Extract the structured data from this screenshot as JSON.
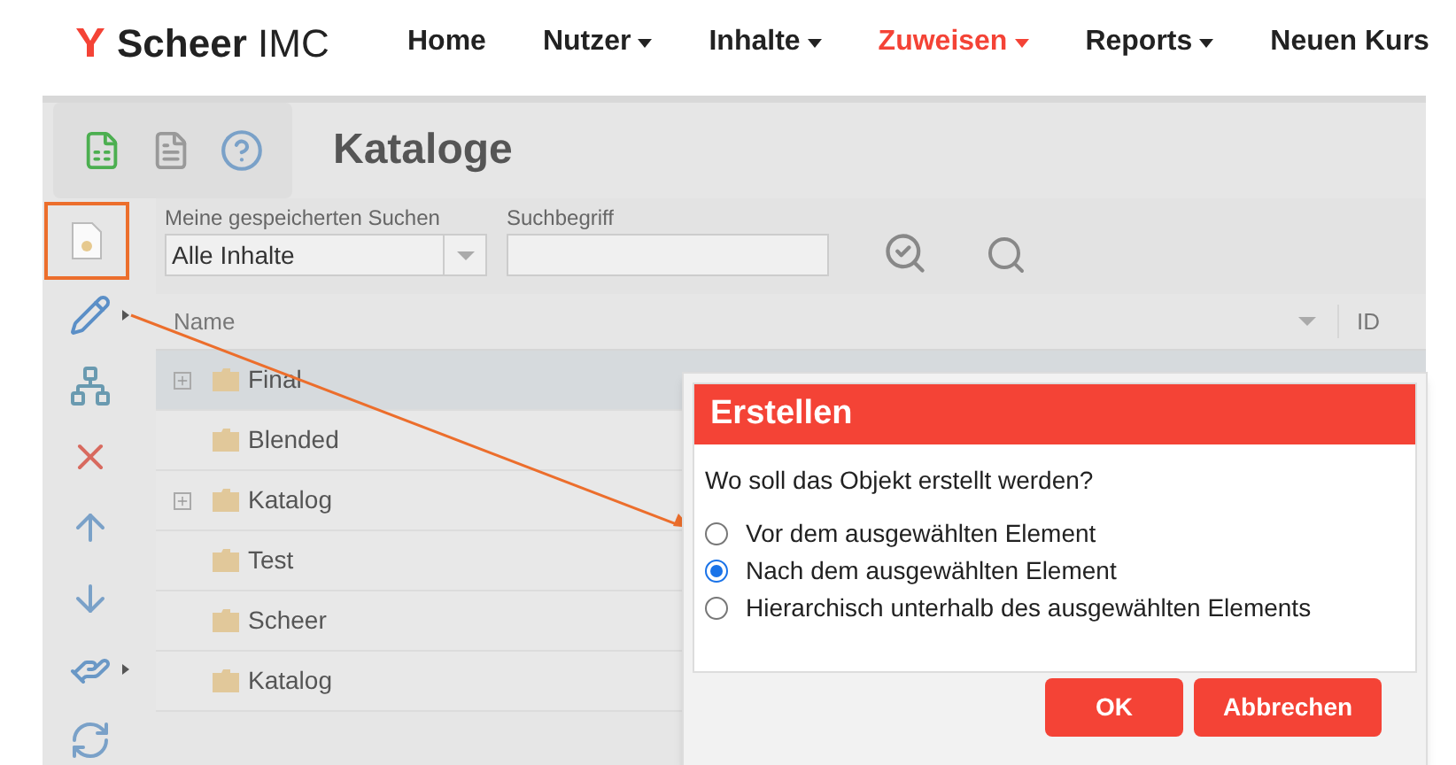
{
  "brand": {
    "name_bold": "Scheer",
    "name_light": "IMC"
  },
  "nav": [
    {
      "label": "Home",
      "has_menu": false,
      "selected": false
    },
    {
      "label": "Nutzer",
      "has_menu": true,
      "selected": false
    },
    {
      "label": "Inhalte",
      "has_menu": true,
      "selected": false
    },
    {
      "label": "Zuweisen",
      "has_menu": true,
      "selected": true
    },
    {
      "label": "Reports",
      "has_menu": true,
      "selected": false
    },
    {
      "label": "Neuen Kurs",
      "has_menu": false,
      "selected": false
    }
  ],
  "page": {
    "title": "Kataloge"
  },
  "search": {
    "saved_label": "Meine gespeicherten Suchen",
    "saved_value": "Alle Inhalte",
    "term_label": "Suchbegriff"
  },
  "table": {
    "columns": [
      "Name",
      "ID"
    ],
    "rows": [
      {
        "name": "Final",
        "expandable": true,
        "selected": true
      },
      {
        "name": "Blended",
        "expandable": false,
        "selected": false
      },
      {
        "name": "Katalog",
        "expandable": true,
        "selected": false
      },
      {
        "name": "Test",
        "expandable": false,
        "selected": false
      },
      {
        "name": "Scheer",
        "expandable": false,
        "selected": false
      },
      {
        "name": "Katalog",
        "expandable": false,
        "selected": false
      }
    ]
  },
  "dialog": {
    "title": "Erstellen",
    "question": "Wo soll das Objekt erstellt werden?",
    "options": [
      {
        "label": "Vor dem ausgewählten Element",
        "selected": false
      },
      {
        "label": "Nach dem ausgewählten Element",
        "selected": true
      },
      {
        "label": "Hierarchisch unterhalb des ausgewählten Elements",
        "selected": false
      }
    ],
    "buttons": [
      "OK",
      "Abbrechen"
    ]
  }
}
